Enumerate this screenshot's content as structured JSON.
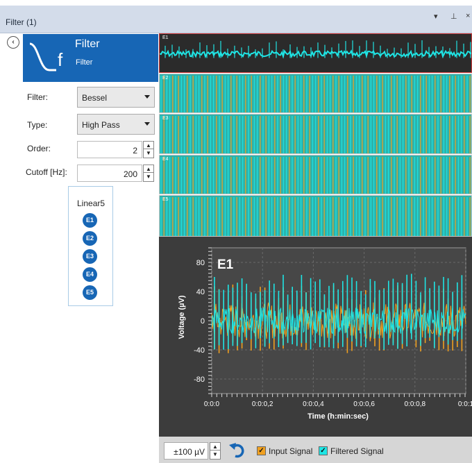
{
  "window": {
    "title": "Filter (1)",
    "controls": [
      "▾",
      "⊥",
      "×"
    ]
  },
  "header": {
    "title": "Filter",
    "subtitle": "Filter",
    "icon": "filter-curve-icon"
  },
  "form": {
    "filter_label": "Filter:",
    "filter_value": "Bessel",
    "type_label": "Type:",
    "type_value": "High Pass",
    "order_label": "Order:",
    "order_value": "2",
    "cutoff_label": "Cutoff [Hz]:",
    "cutoff_value": "200"
  },
  "electrode_group": {
    "title": "Linear5",
    "electrodes": [
      "E1",
      "E2",
      "E3",
      "E4",
      "E5"
    ]
  },
  "strips": [
    "E1",
    "E2",
    "E3",
    "E4",
    "E5"
  ],
  "chart_data": {
    "type": "line",
    "title": "E1",
    "xlabel": "Time (h:min:sec)",
    "ylabel": "Voltage (µV)",
    "x_ticks": [
      "0:0:0",
      "0:0:0,2",
      "0:0:0,4",
      "0:0:0,6",
      "0:0:0,8",
      "0:0:1"
    ],
    "y_ticks": [
      "80",
      "40",
      "0",
      "-40",
      "-80"
    ],
    "ylim": [
      -100,
      100
    ],
    "xlim": [
      0,
      1
    ],
    "grid": true,
    "series": [
      {
        "name": "Input Signal",
        "color": "#f0a020",
        "amplitude_band": [
          -25,
          25
        ],
        "spike_peaks": [
          50,
          -45
        ]
      },
      {
        "name": "Filtered Signal",
        "color": "#1fe5e5",
        "amplitude_band": [
          -18,
          18
        ],
        "spike_peaks": [
          65,
          -40
        ]
      }
    ]
  },
  "bottombar": {
    "scale_value": "±100 µV",
    "input_signal_label": "Input Signal",
    "filtered_signal_label": "Filtered Signal",
    "input_checked": "✓",
    "filtered_checked": "✓"
  },
  "colors": {
    "accent": "#1766b5",
    "strip_bg": "#2cb1aa",
    "input_signal": "#f0a020",
    "filtered_signal": "#1fe5e5",
    "plot_bg": "#3c3c3c"
  }
}
